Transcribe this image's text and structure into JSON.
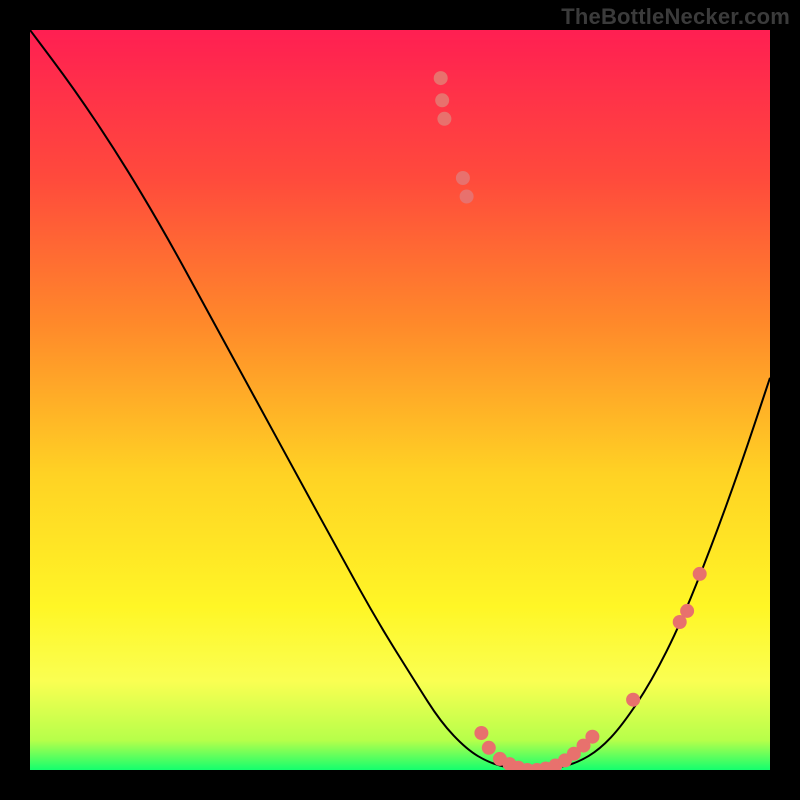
{
  "watermark": "TheBottleNecker.com",
  "chart_data": {
    "type": "line",
    "title": "",
    "xlabel": "",
    "ylabel": "",
    "xlim": [
      0,
      1
    ],
    "ylim": [
      0,
      1
    ],
    "gradient_stops": [
      {
        "offset": 0.0,
        "color": "#ff1f52"
      },
      {
        "offset": 0.2,
        "color": "#ff4a3c"
      },
      {
        "offset": 0.4,
        "color": "#ff8a2a"
      },
      {
        "offset": 0.6,
        "color": "#ffd224"
      },
      {
        "offset": 0.78,
        "color": "#fff626"
      },
      {
        "offset": 0.88,
        "color": "#faff52"
      },
      {
        "offset": 0.96,
        "color": "#b6ff4a"
      },
      {
        "offset": 1.0,
        "color": "#14ff6e"
      }
    ],
    "series": [
      {
        "name": "curve",
        "x": [
          0.0,
          0.06,
          0.12,
          0.18,
          0.24,
          0.3,
          0.36,
          0.42,
          0.47,
          0.52,
          0.555,
          0.59,
          0.62,
          0.65,
          0.68,
          0.71,
          0.74,
          0.77,
          0.8,
          0.84,
          0.88,
          0.92,
          0.96,
          1.0
        ],
        "y": [
          1.0,
          0.92,
          0.83,
          0.73,
          0.62,
          0.51,
          0.4,
          0.29,
          0.2,
          0.12,
          0.065,
          0.028,
          0.01,
          0.002,
          0.0,
          0.002,
          0.01,
          0.028,
          0.06,
          0.12,
          0.2,
          0.3,
          0.41,
          0.53
        ]
      }
    ],
    "markers": [
      {
        "x": 0.555,
        "y": 0.935
      },
      {
        "x": 0.557,
        "y": 0.905
      },
      {
        "x": 0.56,
        "y": 0.88
      },
      {
        "x": 0.585,
        "y": 0.8
      },
      {
        "x": 0.59,
        "y": 0.775
      },
      {
        "x": 0.61,
        "y": 0.05
      },
      {
        "x": 0.62,
        "y": 0.03
      },
      {
        "x": 0.635,
        "y": 0.015
      },
      {
        "x": 0.648,
        "y": 0.008
      },
      {
        "x": 0.66,
        "y": 0.003
      },
      {
        "x": 0.672,
        "y": 0.0
      },
      {
        "x": 0.685,
        "y": 0.0
      },
      {
        "x": 0.697,
        "y": 0.002
      },
      {
        "x": 0.71,
        "y": 0.006
      },
      {
        "x": 0.723,
        "y": 0.013
      },
      {
        "x": 0.735,
        "y": 0.022
      },
      {
        "x": 0.748,
        "y": 0.033
      },
      {
        "x": 0.76,
        "y": 0.045
      },
      {
        "x": 0.815,
        "y": 0.095
      },
      {
        "x": 0.878,
        "y": 0.2
      },
      {
        "x": 0.888,
        "y": 0.215
      },
      {
        "x": 0.905,
        "y": 0.265
      }
    ],
    "marker_color": "#e8716d",
    "marker_radius": 7,
    "curve_color": "#000000",
    "curve_width": 2
  }
}
